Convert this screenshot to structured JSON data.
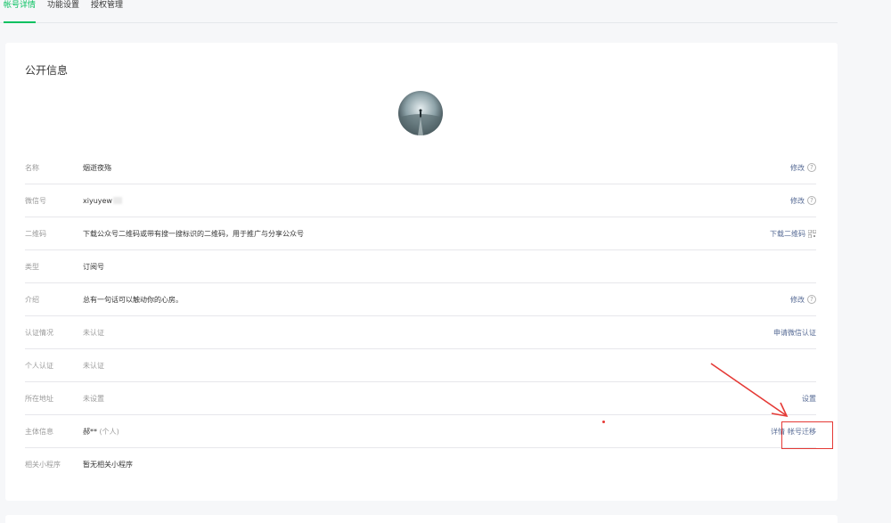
{
  "tabs": [
    {
      "label": "帐号详情",
      "active": true
    },
    {
      "label": "功能设置",
      "active": false
    },
    {
      "label": "授权管理",
      "active": false
    }
  ],
  "section_title": "公开信息",
  "rows": {
    "name": {
      "label": "名称",
      "value": "烟逝夜殇",
      "action": "修改"
    },
    "wechat_id": {
      "label": "微信号",
      "value": "xiyuyew",
      "action": "修改"
    },
    "qrcode": {
      "label": "二维码",
      "value": "下载公众号二维码或带有搜一搜标识的二维码，用于推广与分享公众号",
      "action": "下载二维码"
    },
    "type": {
      "label": "类型",
      "value": "订阅号"
    },
    "intro": {
      "label": "介绍",
      "value": "总有一句话可以触动你的心房。",
      "action": "修改"
    },
    "verification": {
      "label": "认证情况",
      "value": "未认证",
      "action": "申请微信认证"
    },
    "personal_verify": {
      "label": "个人认证",
      "value": "未认证"
    },
    "location": {
      "label": "所在地址",
      "value": "未设置",
      "action": "设置"
    },
    "entity": {
      "label": "主体信息",
      "value": "郝**",
      "note": "(个人)",
      "action_detail": "详情",
      "action_migrate": "帐号迁移"
    },
    "mini_program": {
      "label": "相关小程序",
      "value": "暂无相关小程序"
    }
  },
  "colors": {
    "accent": "#07c160",
    "link": "#576b95",
    "annotation": "#e53935"
  }
}
